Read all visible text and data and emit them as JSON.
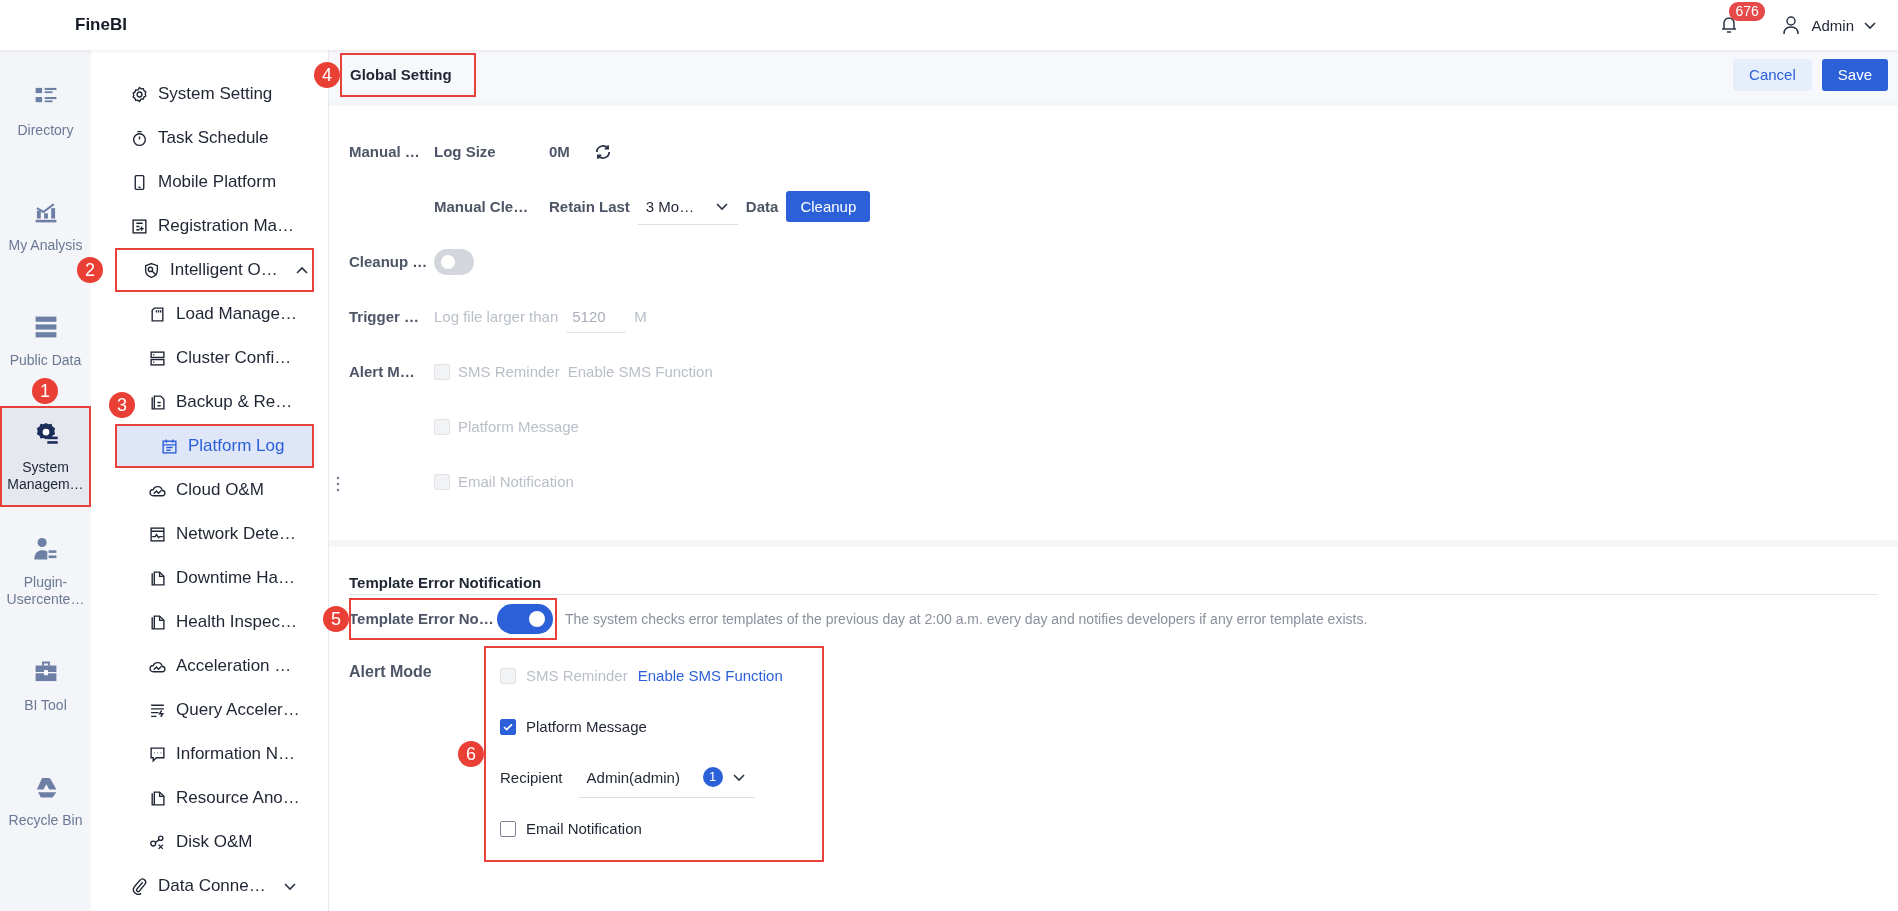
{
  "app": {
    "name": "FineBI"
  },
  "topbar": {
    "notification_count": "676",
    "user": "Admin"
  },
  "rail": [
    {
      "label": "Directory",
      "selected": false
    },
    {
      "label": "My Analysis",
      "selected": false
    },
    {
      "label": "Public Data",
      "selected": false
    },
    {
      "label": "System Managem…",
      "selected": true,
      "marker": "1"
    },
    {
      "label": "Plugin-Usercente…",
      "selected": false
    },
    {
      "label": "BI Tool",
      "selected": false
    },
    {
      "label": "Recycle Bin",
      "selected": false
    }
  ],
  "sidebar": {
    "items": [
      {
        "label": "System Setting",
        "selected": false
      },
      {
        "label": "Task Schedule",
        "selected": false
      },
      {
        "label": "Mobile Platform",
        "selected": false
      },
      {
        "label": "Registration Ma…",
        "selected": false
      },
      {
        "label": "Intelligent O…",
        "selected": false,
        "expanded": true,
        "marker": "2",
        "children": [
          {
            "label": "Load Manage…",
            "selected": false
          },
          {
            "label": "Cluster Confi…",
            "selected": false
          },
          {
            "label": "Backup & Re…",
            "selected": false
          },
          {
            "label": "Platform Log",
            "selected": true,
            "marker": "3"
          },
          {
            "label": "Cloud O&M",
            "selected": false
          },
          {
            "label": "Network Dete…",
            "selected": false
          },
          {
            "label": "Downtime Ha…",
            "selected": false
          },
          {
            "label": "Health Inspec…",
            "selected": false
          },
          {
            "label": "Acceleration …",
            "selected": false
          },
          {
            "label": "Query Acceler…",
            "selected": false
          },
          {
            "label": "Information N…",
            "selected": false
          },
          {
            "label": "Resource Ano…",
            "selected": false
          },
          {
            "label": "Disk O&M",
            "selected": false
          }
        ]
      },
      {
        "label": "Data Conne…",
        "selected": false,
        "expanded": false
      }
    ]
  },
  "header": {
    "title": "Global Setting",
    "marker": "4",
    "buttons": [
      {
        "label": "Cancel",
        "kind": "secondary"
      },
      {
        "label": "Save",
        "kind": "primary"
      }
    ]
  },
  "global": {
    "manual": {
      "label": "Manual …",
      "log_size_label": "Log Size",
      "log_size": "0M",
      "cleanup_label": "Manual Cle…",
      "retain_label": "Retain Last",
      "retain_value": "3 Mo…",
      "data_label": "Data",
      "button": "Cleanup"
    },
    "auto_cleanup": {
      "label": "Cleanup …",
      "on": false
    },
    "trigger": {
      "label": "Trigger …",
      "text": "Log file larger than",
      "value": "5120",
      "unit": "M",
      "disabled": true
    },
    "alert": {
      "label": "Alert M…",
      "options": [
        {
          "label": "SMS Reminder",
          "checked": false,
          "disabled": true,
          "link": "Enable SMS Function"
        },
        {
          "label": "Platform Message",
          "checked": false,
          "disabled": true
        },
        {
          "label": "Email Notification",
          "checked": false,
          "disabled": true
        }
      ]
    }
  },
  "template": {
    "title": "Template Error Notification",
    "toggle": {
      "label": "Template Error No…",
      "on": true,
      "marker": "5",
      "description": "The system checks error templates of the previous day at 2:00 a.m. every day and notifies developers if any error template exists."
    },
    "alert": {
      "label": "Alert Mode",
      "marker": "6",
      "options": [
        {
          "kind": "checkbox",
          "label": "SMS Reminder",
          "checked": false,
          "disabled": true,
          "link": "Enable SMS Function"
        },
        {
          "kind": "checkbox",
          "label": "Platform Message",
          "checked": true,
          "disabled": false
        },
        {
          "kind": "recipient",
          "label": "Recipient",
          "value": "Admin(admin)",
          "count": "1"
        },
        {
          "kind": "checkbox",
          "label": "Email Notification",
          "checked": false,
          "disabled": false
        }
      ]
    }
  }
}
